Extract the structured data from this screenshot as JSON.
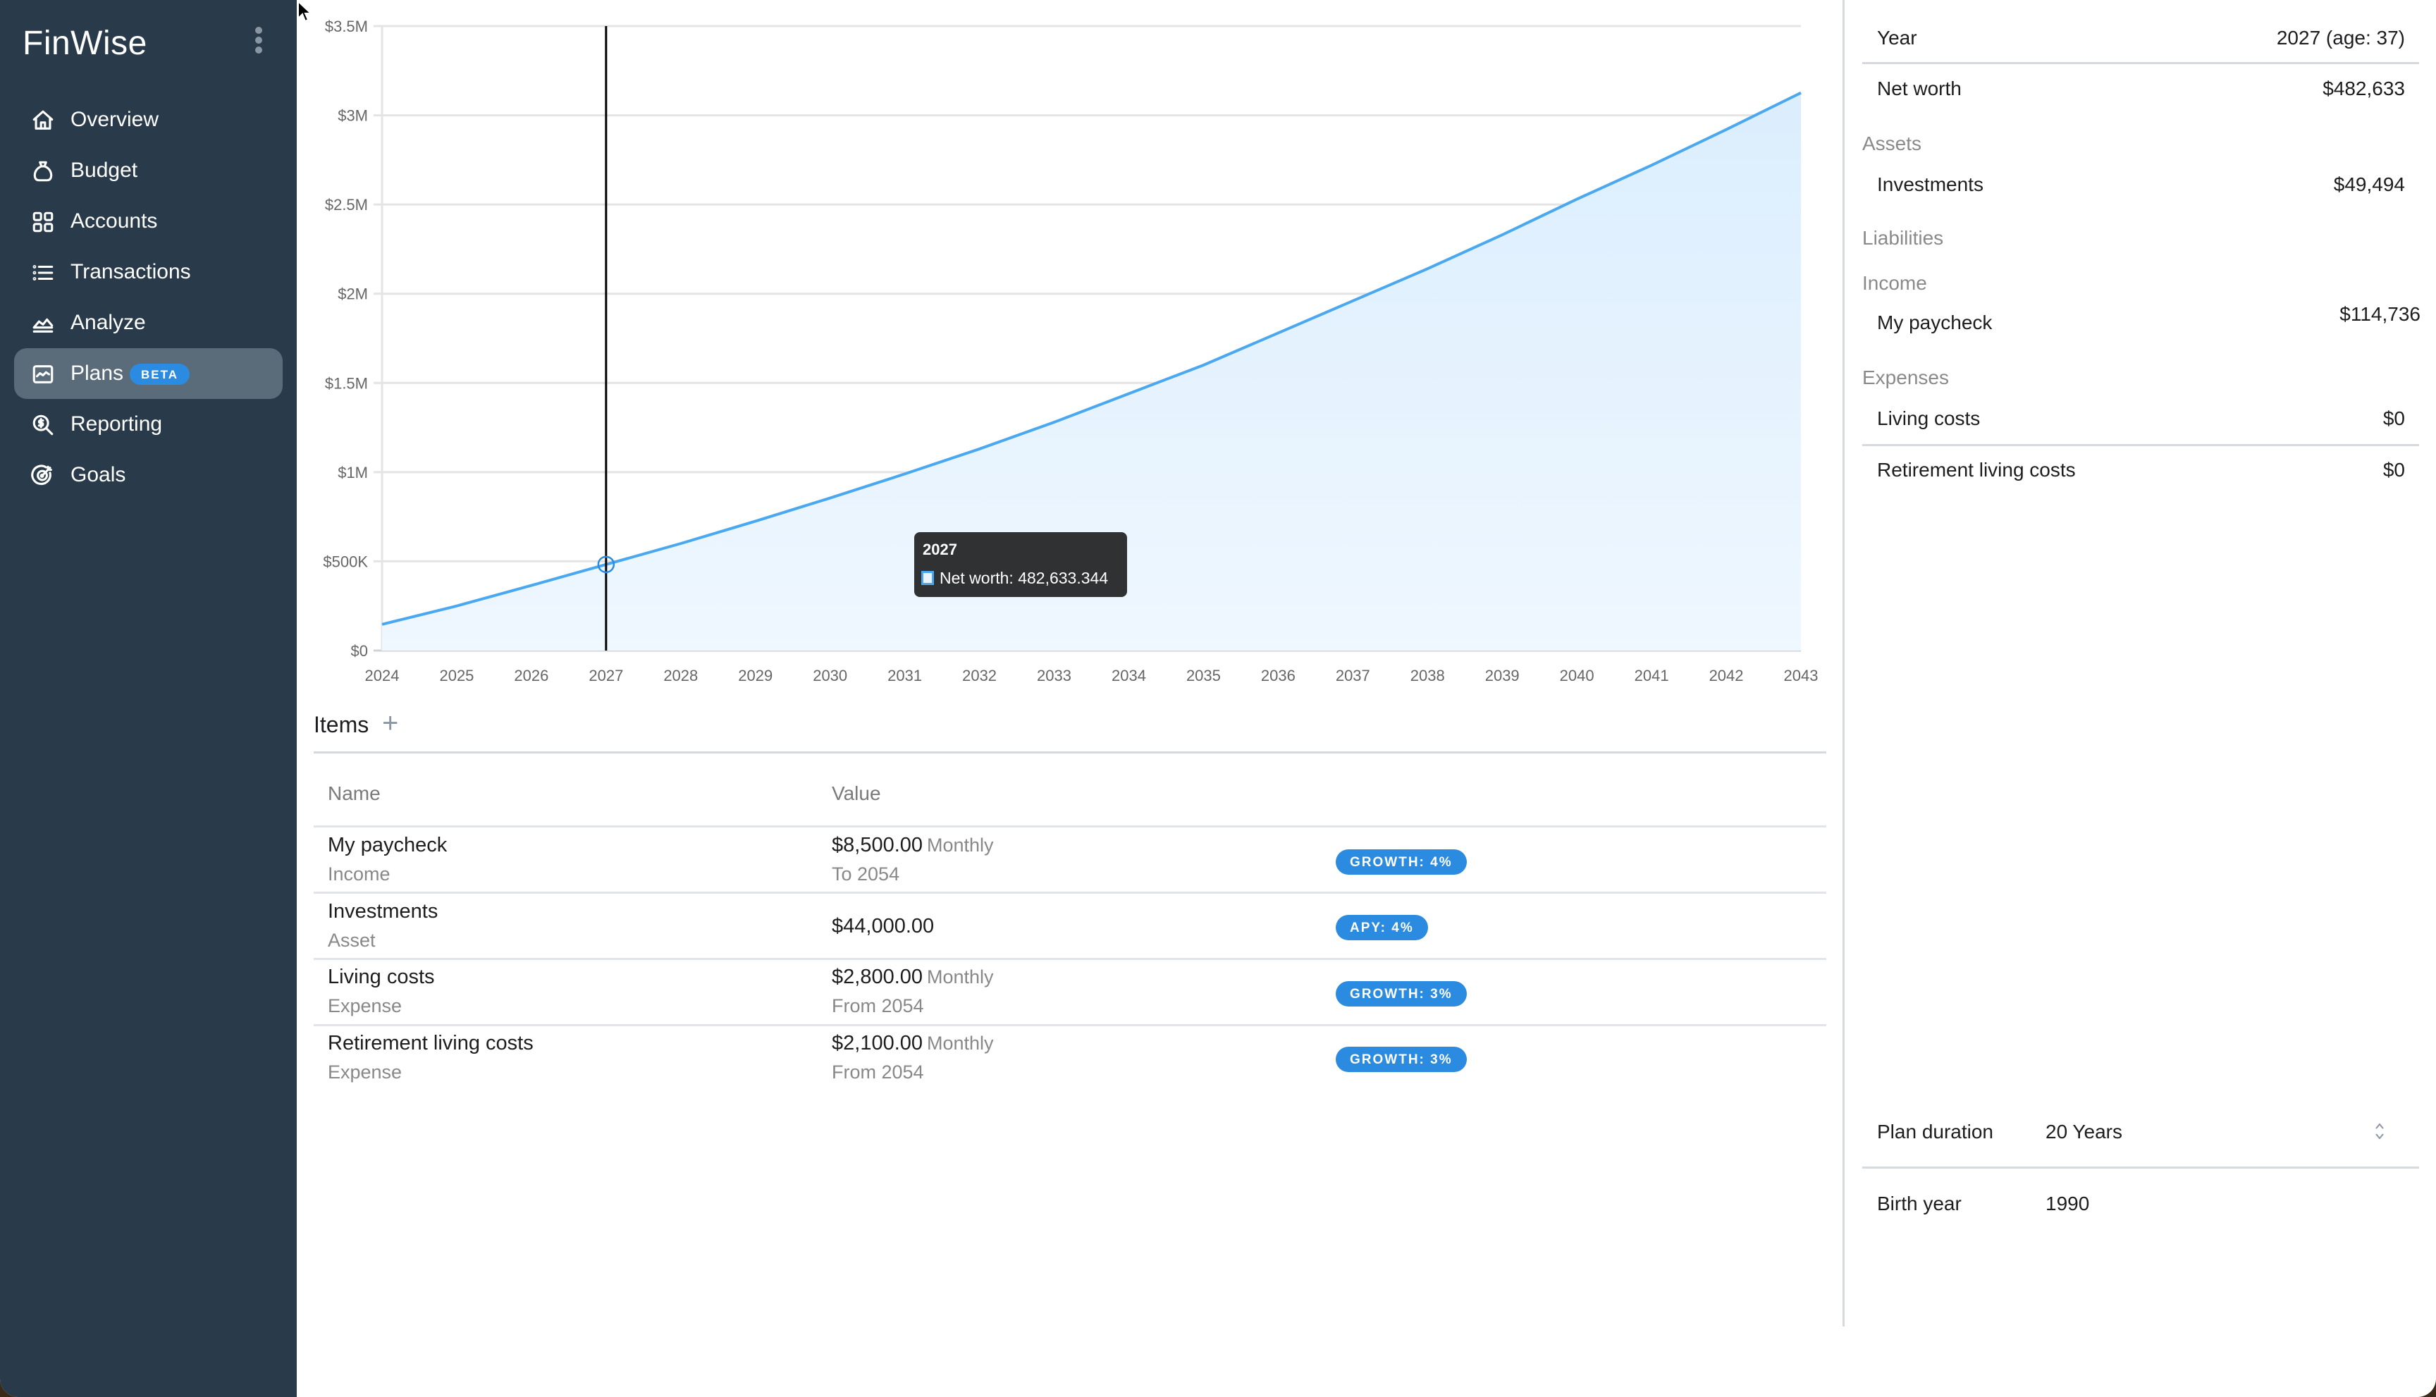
{
  "app": {
    "name": "FinWise",
    "menu_icon": "kebab-menu-icon"
  },
  "sidebar": {
    "items": [
      {
        "label": "Overview",
        "icon": "home-icon",
        "active": false
      },
      {
        "label": "Budget",
        "icon": "money-bag-icon",
        "active": false
      },
      {
        "label": "Accounts",
        "icon": "grid-icon",
        "active": false
      },
      {
        "label": "Transactions",
        "icon": "list-icon",
        "active": false
      },
      {
        "label": "Analyze",
        "icon": "area-chart-icon",
        "active": false
      },
      {
        "label": "Plans",
        "icon": "line-chart-icon",
        "active": true,
        "badge": "BETA"
      },
      {
        "label": "Reporting",
        "icon": "dollar-search-icon",
        "active": false
      },
      {
        "label": "Goals",
        "icon": "target-icon",
        "active": false
      }
    ]
  },
  "colors": {
    "sidebar_bg": "#293a4a",
    "sidebar_active": "#5a6b7a",
    "accent": "#2a8be0",
    "series_line": "#4aa8f0",
    "series_fill": "#dbeefd",
    "tooltip_bg": "#2f3133"
  },
  "chart_data": {
    "type": "area",
    "title": "",
    "xlabel": "",
    "ylabel": "",
    "x": [
      2024,
      2025,
      2026,
      2027,
      2028,
      2029,
      2030,
      2031,
      2032,
      2033,
      2034,
      2035,
      2036,
      2037,
      2038,
      2039,
      2040,
      2041,
      2042,
      2043
    ],
    "series": [
      {
        "name": "Net worth",
        "values": [
          147000,
          250000,
          365000,
          482633.344,
          600000,
          725000,
          855000,
          990000,
          1130000,
          1280000,
          1440000,
          1600000,
          1780000,
          1960000,
          2140000,
          2330000,
          2530000,
          2720000,
          2920000,
          3126000
        ]
      }
    ],
    "x_tick_labels": [
      "2024",
      "2025",
      "2026",
      "2027",
      "2028",
      "2029",
      "2030",
      "2031",
      "2032",
      "2033",
      "2034",
      "2035",
      "2036",
      "2037",
      "2038",
      "2039",
      "2040",
      "2041",
      "2042",
      "2043"
    ],
    "y_ticks": [
      0,
      500000,
      1000000,
      1500000,
      2000000,
      2500000,
      3000000,
      3500000
    ],
    "y_tick_labels": [
      "$0",
      "$500K",
      "$1M",
      "$1.5M",
      "$2M",
      "$2.5M",
      "$3M",
      "$3.5M"
    ],
    "ylim": [
      0,
      3500000
    ],
    "grid": true,
    "legend": "none",
    "hover": {
      "x": 2027,
      "title": "2027",
      "label": "Net worth: 482,633.344"
    }
  },
  "items": {
    "title": "Items",
    "add_icon": "plus-icon",
    "columns": [
      "Name",
      "Value"
    ],
    "rows": [
      {
        "name": "My paycheck",
        "type": "Income",
        "value": "$8,500.00",
        "frequency": "Monthly",
        "period": "To 2054",
        "tag": "GROWTH: 4%"
      },
      {
        "name": "Investments",
        "type": "Asset",
        "value": "$44,000.00",
        "frequency": "",
        "period": "",
        "tag": "APY: 4%"
      },
      {
        "name": "Living costs",
        "type": "Expense",
        "value": "$2,800.00",
        "frequency": "Monthly",
        "period": "From 2054",
        "tag": "GROWTH: 3%"
      },
      {
        "name": "Retirement living costs",
        "type": "Expense",
        "value": "$2,100.00",
        "frequency": "Monthly",
        "period": "From 2054",
        "tag": "GROWTH: 3%"
      }
    ]
  },
  "summary": {
    "year_label": "Year",
    "year_value": "2027 (age: 37)",
    "net_worth_label": "Net worth",
    "net_worth_value": "$482,633",
    "sections": {
      "assets": "Assets",
      "liabilities": "Liabilities",
      "income": "Income",
      "expenses": "Expenses"
    },
    "investments_label": "Investments",
    "investments_value": "$49,494",
    "paycheck_label": "My paycheck",
    "paycheck_value": "$114,736",
    "living_costs_label": "Living costs",
    "living_costs_value": "$0",
    "retirement_label": "Retirement living costs",
    "retirement_value": "$0"
  },
  "settings": {
    "plan_duration_label": "Plan duration",
    "plan_duration_value": "20 Years",
    "birth_year_label": "Birth year",
    "birth_year_value": "1990"
  }
}
